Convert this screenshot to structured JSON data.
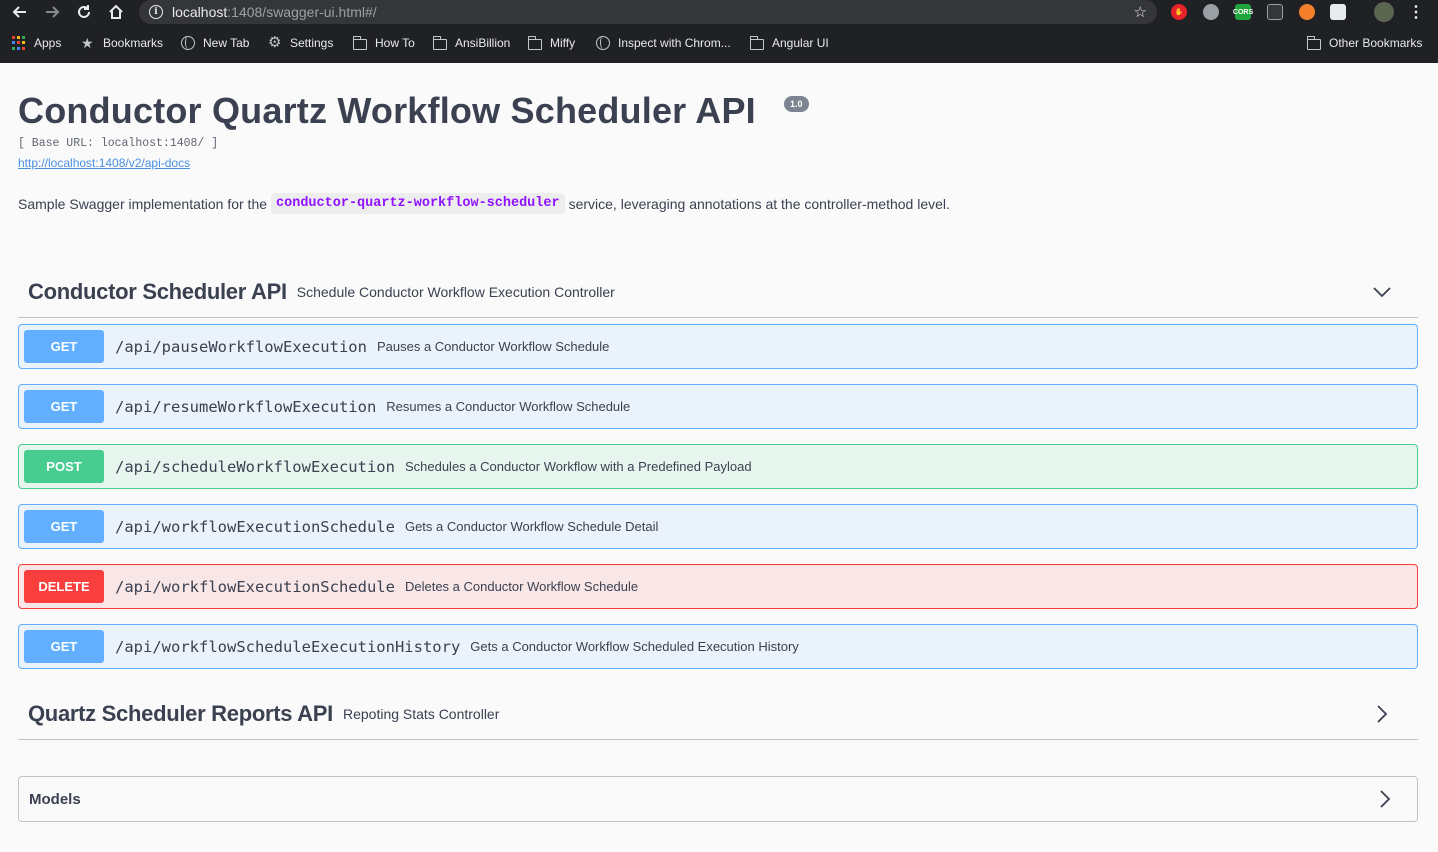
{
  "browser": {
    "url_host": "localhost",
    "url_rest": ":1408/swagger-ui.html#/",
    "bookmarks": [
      {
        "label": "Apps",
        "icon": "apps-icon"
      },
      {
        "label": "Bookmarks",
        "icon": "star-icon"
      },
      {
        "label": "New Tab",
        "icon": "globe-icon"
      },
      {
        "label": "Settings",
        "icon": "gear-icon"
      },
      {
        "label": "How To",
        "icon": "folder-icon"
      },
      {
        "label": "AnsiBillion",
        "icon": "folder-icon"
      },
      {
        "label": "Miffy",
        "icon": "folder-icon"
      },
      {
        "label": "Inspect with Chrom...",
        "icon": "globe-icon"
      },
      {
        "label": "Angular UI",
        "icon": "folder-icon"
      },
      {
        "label": "Other Bookmarks",
        "icon": "folder-icon"
      }
    ],
    "extensions": [
      "cors-extension",
      "ext-icon"
    ]
  },
  "swagger": {
    "title": "Conductor Quartz Workflow Scheduler API",
    "version": "1.0",
    "base_url": "[ Base URL: localhost:1408/ ]",
    "docs_link": "http://localhost:1408/v2/api-docs",
    "description_before": "Sample Swagger implementation for the",
    "description_code": "conductor-quartz-workflow-scheduler",
    "description_after": "service, leveraging annotations at the controller-method level."
  },
  "tags": [
    {
      "name": "Conductor Scheduler API",
      "description": "Schedule Conductor Workflow Execution Controller",
      "expanded": true,
      "operations": [
        {
          "method": "GET",
          "path": "/api/pauseWorkflowExecution",
          "summary": "Pauses a Conductor Workflow Schedule"
        },
        {
          "method": "GET",
          "path": "/api/resumeWorkflowExecution",
          "summary": "Resumes a Conductor Workflow Schedule"
        },
        {
          "method": "POST",
          "path": "/api/scheduleWorkflowExecution",
          "summary": "Schedules a Conductor Workflow with a Predefined Payload"
        },
        {
          "method": "GET",
          "path": "/api/workflowExecutionSchedule",
          "summary": "Gets a Conductor Workflow Schedule Detail"
        },
        {
          "method": "DELETE",
          "path": "/api/workflowExecutionSchedule",
          "summary": "Deletes a Conductor Workflow Schedule"
        },
        {
          "method": "GET",
          "path": "/api/workflowScheduleExecutionHistory",
          "summary": "Gets a Conductor Workflow Scheduled Execution History"
        }
      ]
    },
    {
      "name": "Quartz Scheduler Reports API",
      "description": "Repoting Stats Controller",
      "expanded": false
    }
  ],
  "models": {
    "title": "Models"
  },
  "colors": {
    "get": "#61affe",
    "post": "#49cc90",
    "delete": "#f93e3e",
    "text": "#3b4151"
  }
}
